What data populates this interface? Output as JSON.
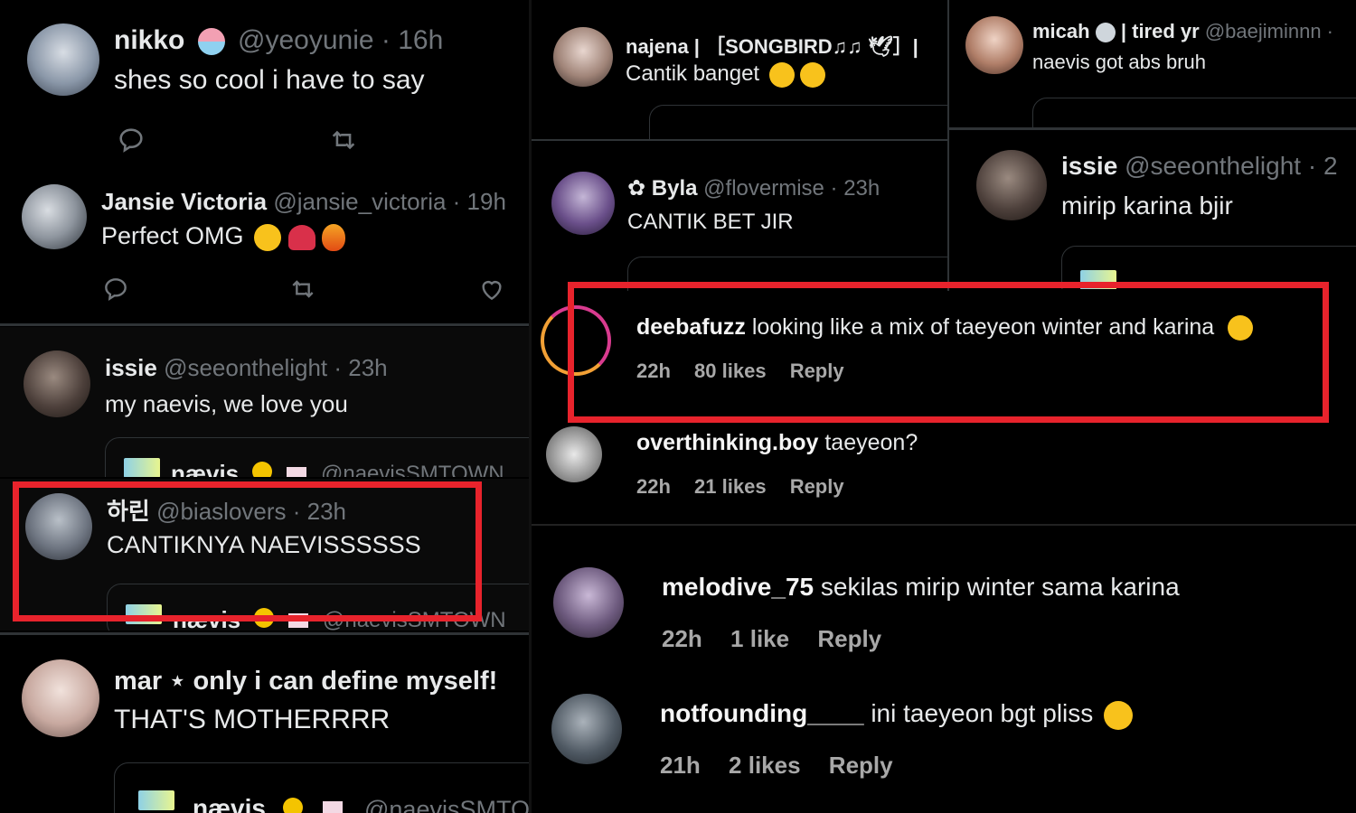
{
  "colors": {
    "highlight": "#e8232c",
    "handle": "#71767b",
    "text": "#e7e9ea",
    "quote_logo": "#8ed1e6"
  },
  "tweets": {
    "nikko": {
      "name": "nikko",
      "handle": "@yeoyunie · 16h",
      "text": "shes so cool i have to say"
    },
    "jansie": {
      "name": "Jansie Victoria",
      "handle": "@jansie_victoria · 19h",
      "text": "Perfect OMG"
    },
    "issie1": {
      "name": "issie",
      "handle": "@seeonthelight · 23h",
      "text": "my naevis, we love you"
    },
    "harin": {
      "name": "하린",
      "handle": "@biaslovers · 23h",
      "text": "CANTIKNYA NAEVISSSSSS"
    },
    "mar": {
      "name": "mar ⋆ only i can define myself!",
      "text": "THAT'S MOTHERRRR"
    },
    "najena": {
      "name": "najena | ［SONGBIRD♫♫ 🕊］|",
      "text": "Cantik banget"
    },
    "byla": {
      "name": "✿ Byla",
      "handle": "@flovermise · 23h",
      "text": "CANTIK BET JIR"
    },
    "micah": {
      "name": "micah",
      "name_suffix": "| tired yr",
      "handle": "@baejiminnn ·",
      "text": "naevis got abs bruh"
    },
    "issie2": {
      "name": "issie",
      "handle": "@seeonthelight · 2",
      "text": "mirip karina bjir"
    }
  },
  "quote": {
    "name": "nævis",
    "handle": "@naevisSMTOWN"
  },
  "comments": [
    {
      "username": "deebafuzz",
      "text": "looking like a mix of taeyeon winter and karina",
      "time": "22h",
      "likes": "80 likes",
      "reply": "Reply"
    },
    {
      "username": "overthinking.boy",
      "text": "taeyeon?",
      "time": "22h",
      "likes": "21 likes",
      "reply": "Reply"
    },
    {
      "username": "melodive_75",
      "text": "sekilas mirip winter sama karina",
      "time": "22h",
      "likes": "1 like",
      "reply": "Reply"
    },
    {
      "username": "notfounding____",
      "text": "ini taeyeon bgt pliss",
      "time": "21h",
      "likes": "2 likes",
      "reply": "Reply"
    }
  ],
  "icons": [
    "reply-icon",
    "retweet-icon",
    "like-icon",
    "verified-badge-icon",
    "alien-icon",
    "flower-icon"
  ]
}
